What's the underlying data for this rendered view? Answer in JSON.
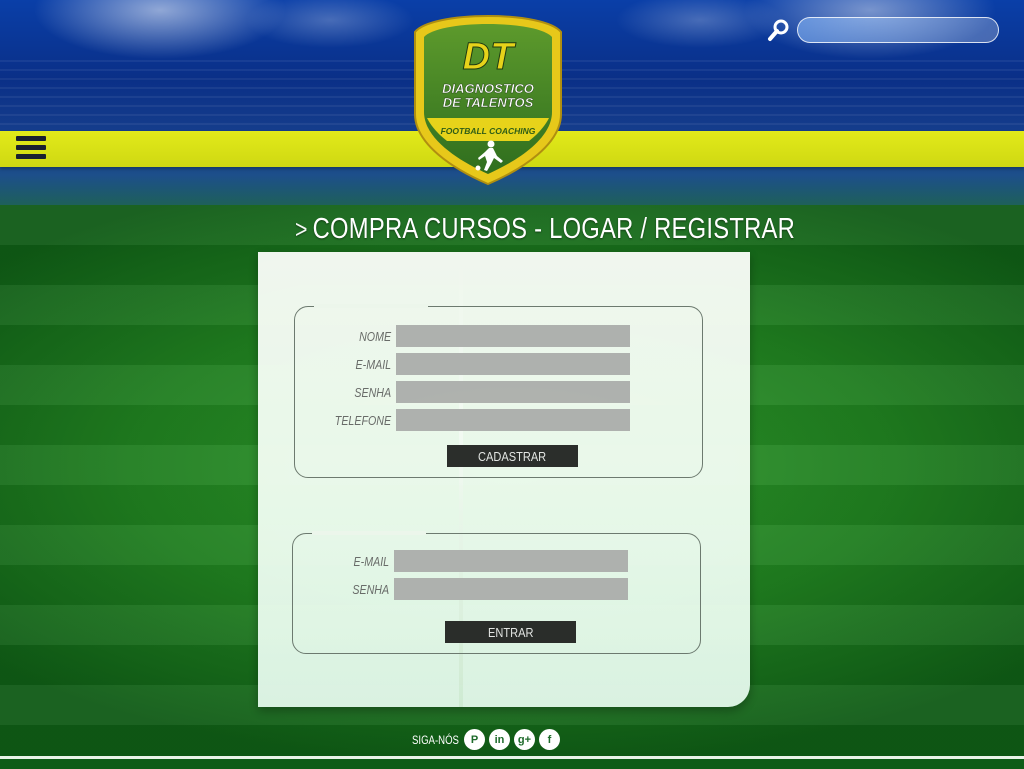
{
  "header": {
    "logo": {
      "initials": "DT",
      "line1": "DIAGNOSTICO",
      "line2": "DE TALENTOS",
      "tagline": "FOOTBALL COACHING"
    },
    "search": {
      "placeholder": ""
    },
    "menu_icon": "hamburger-icon",
    "search_icon": "magnifier-icon"
  },
  "page": {
    "title": "COMPRA CURSOS - LOGAR / REGISTRAR",
    "title_icon": "chevron-right-icon"
  },
  "register_form": {
    "fields": [
      {
        "label": "NOME",
        "value": ""
      },
      {
        "label": "E-MAIL",
        "value": ""
      },
      {
        "label": "SENHA",
        "value": ""
      },
      {
        "label": "TELEFONE",
        "value": ""
      }
    ],
    "submit_label": "CADASTRAR"
  },
  "login_form": {
    "fields": [
      {
        "label": "E-MAIL",
        "value": ""
      },
      {
        "label": "SENHA",
        "value": ""
      }
    ],
    "submit_label": "ENTRAR"
  },
  "footer": {
    "follow_label": "SIGA-NÓS",
    "social": [
      {
        "name": "pinterest-icon",
        "glyph": "P"
      },
      {
        "name": "linkedin-icon",
        "glyph": "in"
      },
      {
        "name": "google-plus-icon",
        "glyph": "g+"
      },
      {
        "name": "facebook-icon",
        "glyph": "f"
      }
    ]
  },
  "colors": {
    "brand_yellow": "#d8e016",
    "brand_blue": "#0a3fa8",
    "pitch_green": "#1f7d1f",
    "button_dark": "#2b2b2b",
    "field_gray": "#b3b3b3"
  }
}
